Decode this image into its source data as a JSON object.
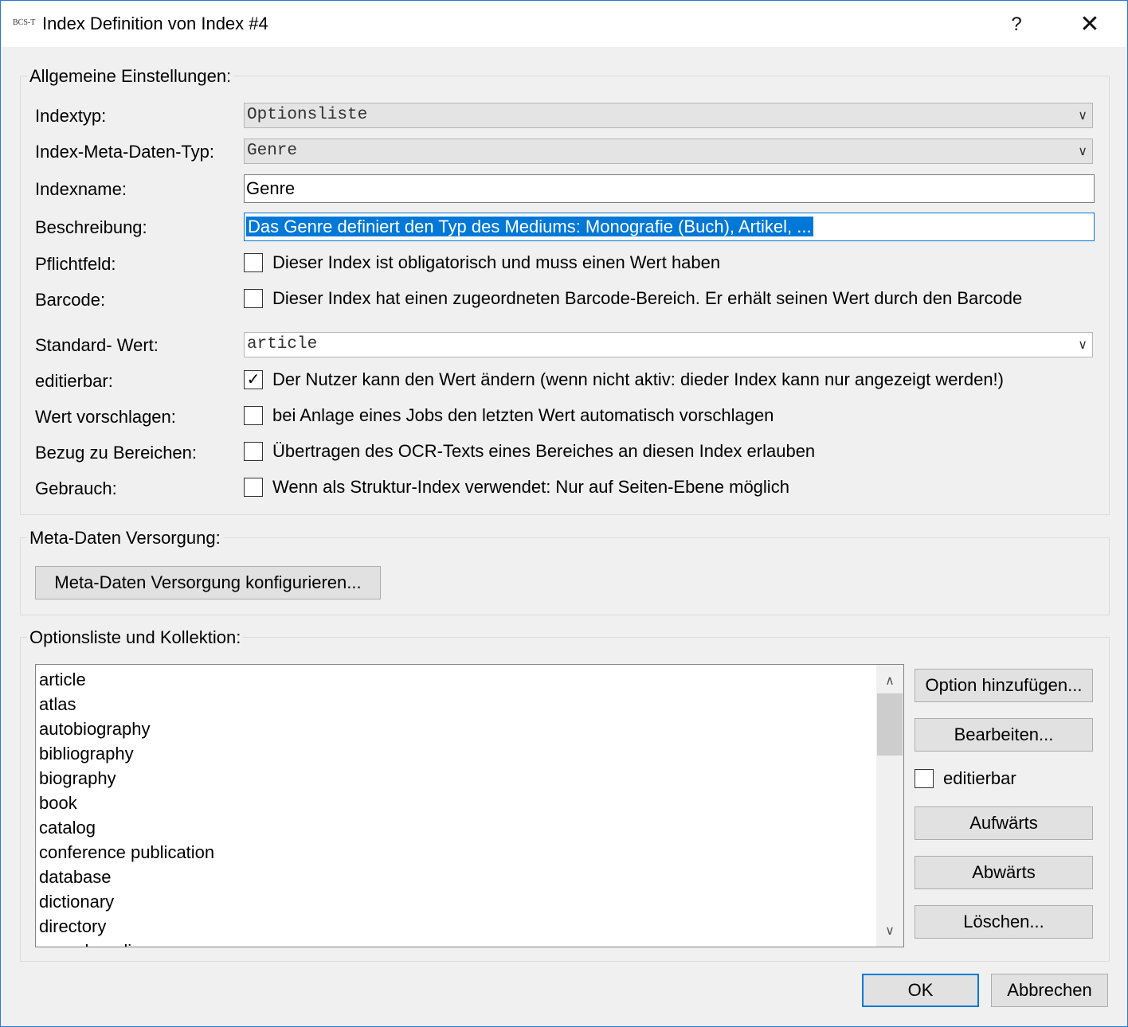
{
  "window": {
    "app_icon_text": "BCS-T",
    "title": "Index Definition von Index #4",
    "help_label": "?",
    "close_label": "✕"
  },
  "general": {
    "group_label": "Allgemeine Einstellungen:",
    "indextyp_label": "Indextyp:",
    "indextyp_value": "Optionsliste",
    "metatyp_label": "Index-Meta-Daten-Typ:",
    "metatyp_value": "Genre",
    "indexname_label": "Indexname:",
    "indexname_value": "Genre",
    "beschreibung_label": "Beschreibung:",
    "beschreibung_value": "Das Genre definiert den Typ des Mediums: Monografie (Buch), Artikel, ...",
    "pflichtfeld_label": "Pflichtfeld:",
    "pflichtfeld_text": "Dieser Index ist obligatorisch und muss einen Wert haben",
    "pflichtfeld_checked": false,
    "barcode_label": "Barcode:",
    "barcode_text": "Dieser Index hat einen zugeordneten Barcode-Bereich. Er erhält seinen Wert durch den Barcode",
    "barcode_checked": false,
    "standard_label": "Standard- Wert:",
    "standard_value": "article",
    "editierbar_label": "editierbar:",
    "editierbar_text": "Der Nutzer kann den Wert ändern (wenn nicht aktiv: dieder Index kann nur angezeigt werden!)",
    "editierbar_checked": true,
    "vorschlagen_label": "Wert vorschlagen:",
    "vorschlagen_text": "bei Anlage eines Jobs den letzten Wert automatisch vorschlagen",
    "vorschlagen_checked": false,
    "bezug_label": "Bezug zu Bereichen:",
    "bezug_text": "Übertragen des OCR-Texts eines Bereiches an diesen Index erlauben",
    "bezug_checked": false,
    "gebrauch_label": "Gebrauch:",
    "gebrauch_text": "Wenn als Struktur-Index verwendet: Nur auf Seiten-Ebene möglich",
    "gebrauch_checked": false
  },
  "meta": {
    "group_label": "Meta-Daten Versorgung:",
    "configure_button": "Meta-Daten Versorgung konfigurieren..."
  },
  "options": {
    "group_label": "Optionsliste und Kollektion:",
    "items": [
      "article",
      "atlas",
      "autobiography",
      "bibliography",
      "biography",
      "book",
      "catalog",
      "conference publication",
      "database",
      "dictionary",
      "directory",
      "encyclopedia"
    ],
    "add_button": "Option hinzufügen...",
    "edit_button": "Bearbeiten...",
    "editierbar_label": "editierbar",
    "editierbar_checked": false,
    "up_button": "Aufwärts",
    "down_button": "Abwärts",
    "delete_button": "Löschen..."
  },
  "footer": {
    "ok_button": "OK",
    "cancel_button": "Abbrechen"
  }
}
